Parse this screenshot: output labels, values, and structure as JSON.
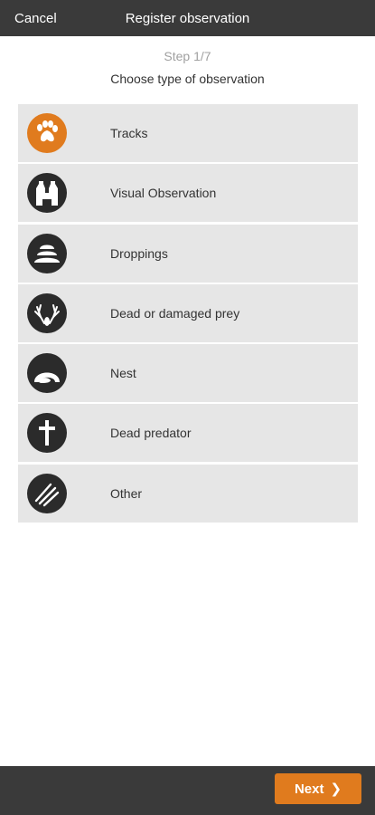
{
  "header": {
    "cancel_label": "Cancel",
    "title": "Register observation"
  },
  "step_label": "Step 1/7",
  "subtitle": "Choose type of observation",
  "items": [
    {
      "label": "Tracks",
      "icon": "paw-icon",
      "color": "#e07b1e"
    },
    {
      "label": "Visual Observation",
      "icon": "binoculars-icon",
      "color": "#2b2b2b"
    },
    {
      "label": "Droppings",
      "icon": "droppings-icon",
      "color": "#2b2b2b"
    },
    {
      "label": "Dead or damaged prey",
      "icon": "antlers-icon",
      "color": "#2b2b2b"
    },
    {
      "label": "Nest",
      "icon": "nest-icon",
      "color": "#2b2b2b"
    },
    {
      "label": "Dead predator",
      "icon": "cross-icon",
      "color": "#2b2b2b"
    },
    {
      "label": "Other",
      "icon": "other-icon",
      "color": "#2b2b2b"
    }
  ],
  "footer": {
    "next_label": "Next",
    "next_icon": "chevron-right-icon"
  },
  "colors": {
    "bar": "#3a3a3a",
    "accent": "#e07b1e",
    "row": "#e6e6e6"
  }
}
